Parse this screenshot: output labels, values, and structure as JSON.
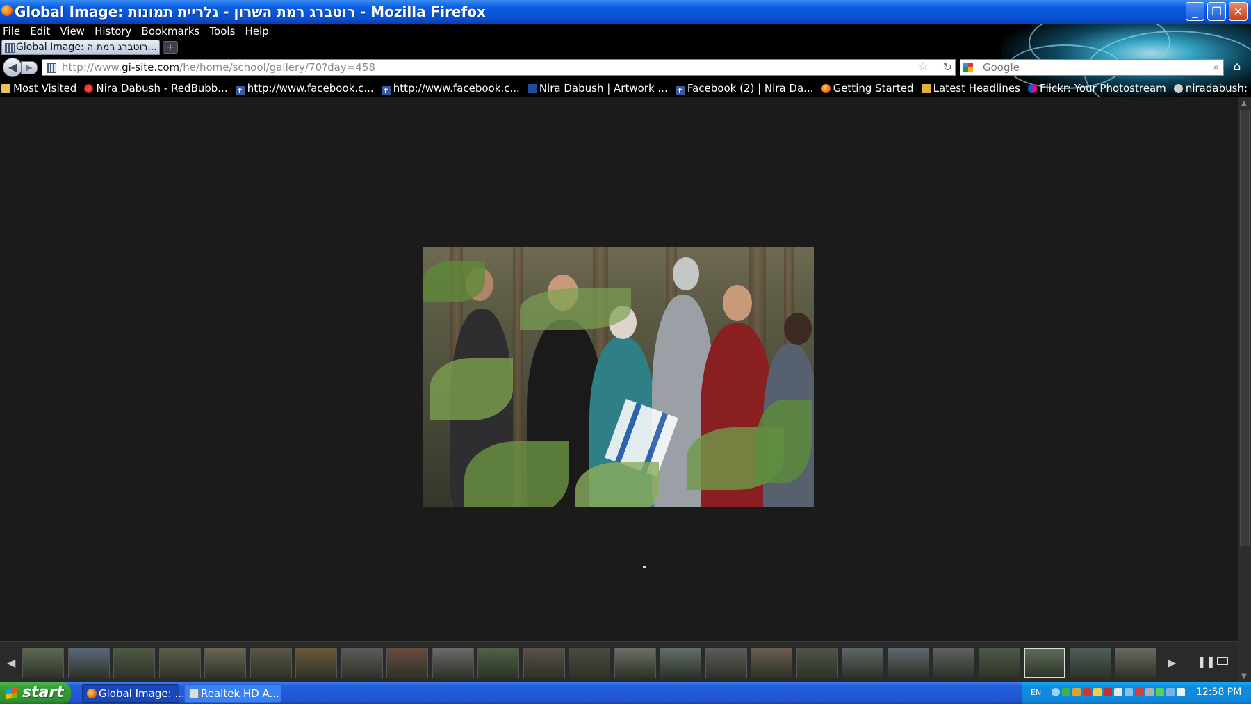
{
  "window": {
    "title": "Global Image: רוטברג רמת השרון - גלריית תמונות - Mozilla Firefox",
    "controls": {
      "minimize": "_",
      "maximize": "❐",
      "close": "✕"
    }
  },
  "menu": [
    "File",
    "Edit",
    "View",
    "History",
    "Bookmarks",
    "Tools",
    "Help"
  ],
  "tab": {
    "title": "Global Image: רוטברג רמת ה...",
    "new_tab": "+"
  },
  "nav": {
    "url_prefix": "http://www.",
    "url_domain": "gi-site.com",
    "url_path": "/he/home/school/gallery/70?day=458",
    "search_placeholder": "Google"
  },
  "bookmarks": [
    {
      "label": "Most Visited",
      "icon": "folder-icon"
    },
    {
      "label": "Nira Dabush - RedBubb...",
      "icon": "redbubble-icon"
    },
    {
      "label": "http://www.facebook.c...",
      "icon": "facebook-icon"
    },
    {
      "label": "http://www.facebook.c...",
      "icon": "facebook-icon"
    },
    {
      "label": "Nira Dabush | Artwork ...",
      "icon": "artwork-icon"
    },
    {
      "label": "Facebook (2) | Nira Da...",
      "icon": "facebook-icon"
    },
    {
      "label": "Getting Started",
      "icon": "firefox-icon"
    },
    {
      "label": "Latest Headlines",
      "icon": "rss-icon"
    },
    {
      "label": "Flickr: Your Photostream",
      "icon": "flickr-icon"
    },
    {
      "label": "niradabush: Home: zaz...",
      "icon": "zazzle-icon"
    }
  ],
  "gallery": {
    "thumbnail_count": 25,
    "active_thumbnail": 23,
    "thumb_colors": [
      "#5d6a55",
      "#59677a",
      "#4f5a45",
      "#5d5f4a",
      "#6a6650",
      "#5a5546",
      "#6d5a3a",
      "#5b5d58",
      "#6a4a3e",
      "#6b6c68",
      "#4f6344",
      "#5a5048",
      "#4a4a40",
      "#6a7068",
      "#616d6c",
      "#5a5d58",
      "#6b5d52",
      "#4e5547",
      "#5e6666",
      "#5f6870",
      "#5d6160",
      "#4d5a48",
      "#5c6d58",
      "#4f5e5a",
      "#6a6a5e"
    ]
  },
  "taskbar": {
    "start_label": "start",
    "buttons": [
      {
        "label": "Global Image: ...",
        "active": true
      },
      {
        "label": "Realtek HD A...",
        "active": false
      }
    ],
    "language": "EN",
    "clock": "12:58 PM"
  }
}
